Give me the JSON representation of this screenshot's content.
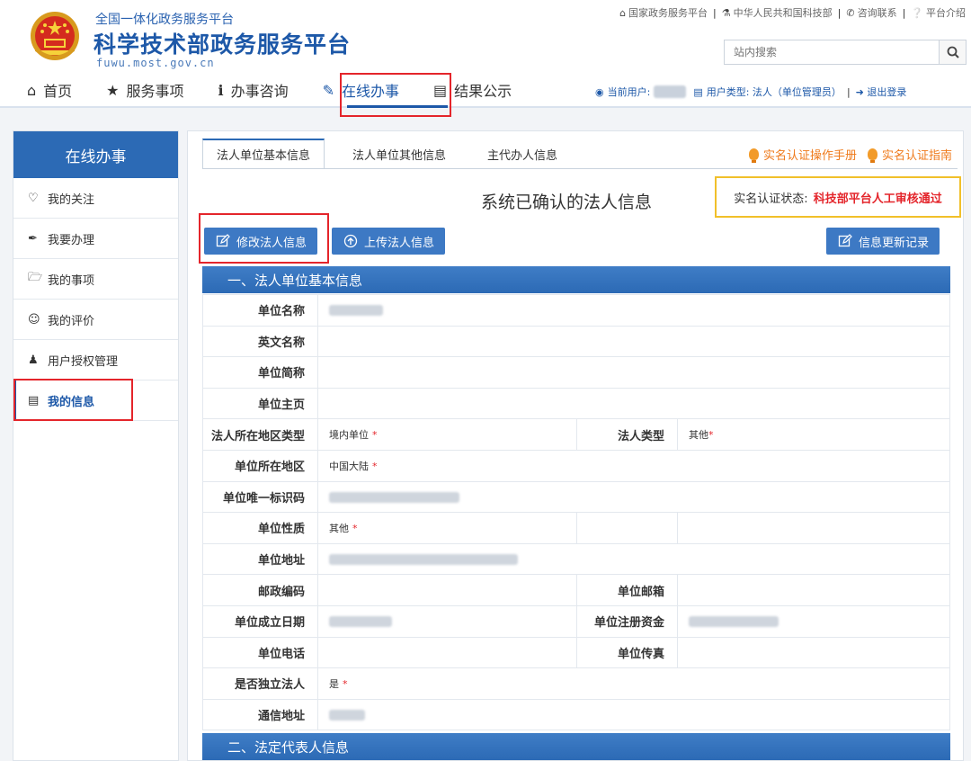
{
  "site": {
    "subtitle": "全国一体化政务服务平台",
    "title": "科学技术部政务服务平台",
    "domain": "fuwu.most.gov.cn"
  },
  "toplinks": [
    {
      "icon": "home-icon",
      "label": "国家政务服务平台"
    },
    {
      "icon": "bank-icon",
      "label": "中华人民共和国科技部"
    },
    {
      "icon": "phone-icon",
      "label": "咨询联系"
    },
    {
      "icon": "question-icon",
      "label": "平台介绍"
    }
  ],
  "search": {
    "placeholder": "站内搜索"
  },
  "nav": [
    {
      "icon": "home-icon",
      "label": "首页"
    },
    {
      "icon": "star-icon",
      "label": "服务事项"
    },
    {
      "icon": "info-icon",
      "label": "办事咨询"
    },
    {
      "icon": "pencil-icon",
      "label": "在线办事"
    },
    {
      "icon": "book-icon",
      "label": "结果公示"
    }
  ],
  "userbar": {
    "current_user_label": "当前用户:",
    "user_type": "用户类型: 法人（单位管理员）",
    "logout": "退出登录"
  },
  "sidebar": {
    "title": "在线办事",
    "items": [
      {
        "icon": "heart-icon",
        "label": "我的关注"
      },
      {
        "icon": "pen-icon",
        "label": "我要办理"
      },
      {
        "icon": "folder-icon",
        "label": "我的事项"
      },
      {
        "icon": "smile-icon",
        "label": "我的评价"
      },
      {
        "icon": "user-auth-icon",
        "label": "用户授权管理"
      },
      {
        "icon": "id-card-icon",
        "label": "我的信息"
      }
    ]
  },
  "tabs": [
    "法人单位基本信息",
    "法人单位其他信息",
    "主代办人信息"
  ],
  "guides": [
    "实名认证操作手册",
    "实名认证指南"
  ],
  "confirm_title": "系统已确认的法人信息",
  "status": {
    "label": "实名认证状态:",
    "value": "科技部平台人工审核通过"
  },
  "buttons": {
    "edit": "修改法人信息",
    "upload": "上传法人信息",
    "history": "信息更新记录"
  },
  "section1": "一、法人单位基本信息",
  "section2": "二、法定代表人信息",
  "fields": {
    "name": "单位名称",
    "en_name": "英文名称",
    "short_name": "单位简称",
    "homepage": "单位主页",
    "region_type": "法人所在地区类型",
    "region_type_value": "境内单位",
    "legal_type": "法人类型",
    "legal_type_value": "其他",
    "location": "单位所在地区",
    "location_value": "中国大陆",
    "uid": "单位唯一标识码",
    "nature": "单位性质",
    "nature_value": "其他",
    "address": "单位地址",
    "postcode": "邮政编码",
    "email": "单位邮箱",
    "founded": "单位成立日期",
    "capital": "单位注册资金",
    "phone": "单位电话",
    "fax": "单位传真",
    "independent": "是否独立法人",
    "independent_value": "是",
    "mail_address": "通信地址"
  },
  "colors": {
    "primary": "#2c6ab5",
    "highlight": "#e4252b",
    "status_border": "#f1c02a",
    "guide": "#ef7a1b"
  }
}
